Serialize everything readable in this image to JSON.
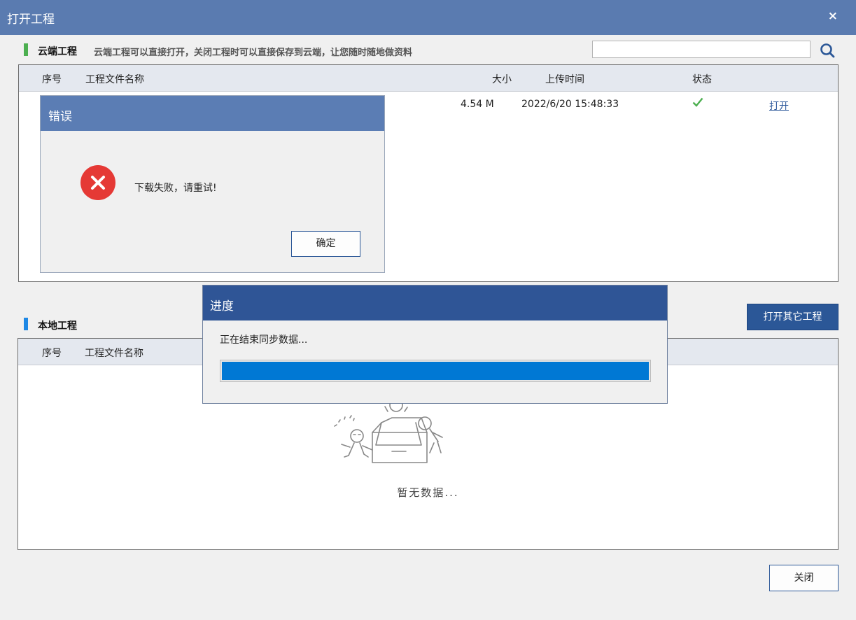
{
  "window": {
    "title": "打开工程",
    "close_glyph": "×"
  },
  "cloud": {
    "heading": "云端工程",
    "description": "云端工程可以直接打开，关闭工程时可以直接保存到云端，让您随时随地做资料",
    "accent_color": "#4caf50",
    "search": {
      "value": "",
      "placeholder": "",
      "icon": "search-icon"
    },
    "columns": {
      "index": "序号",
      "name": "工程文件名称",
      "size": "大小",
      "upload_time": "上传时间",
      "status": "状态"
    },
    "rows": [
      {
        "size": "4.54 M",
        "upload_time": "2022/6/20 15:48:33",
        "status_icon": "check-icon",
        "status_color": "#4caf50",
        "action": "打开"
      }
    ]
  },
  "local": {
    "heading": "本地工程",
    "accent_color": "#1e88e5",
    "open_other_label": "打开其它工程",
    "columns": {
      "index": "序号",
      "name": "工程文件名称"
    },
    "empty_text": "暂无数据..."
  },
  "footer": {
    "close_label": "关闭"
  },
  "error_dialog": {
    "title": "错误",
    "message": "下载失败，请重试!",
    "ok_label": "确定",
    "icon": "error-icon",
    "icon_color": "#e53935"
  },
  "progress_dialog": {
    "title": "进度",
    "message": "正在结束同步数据...",
    "progress": 1.0,
    "bar_color": "#0078d4"
  }
}
